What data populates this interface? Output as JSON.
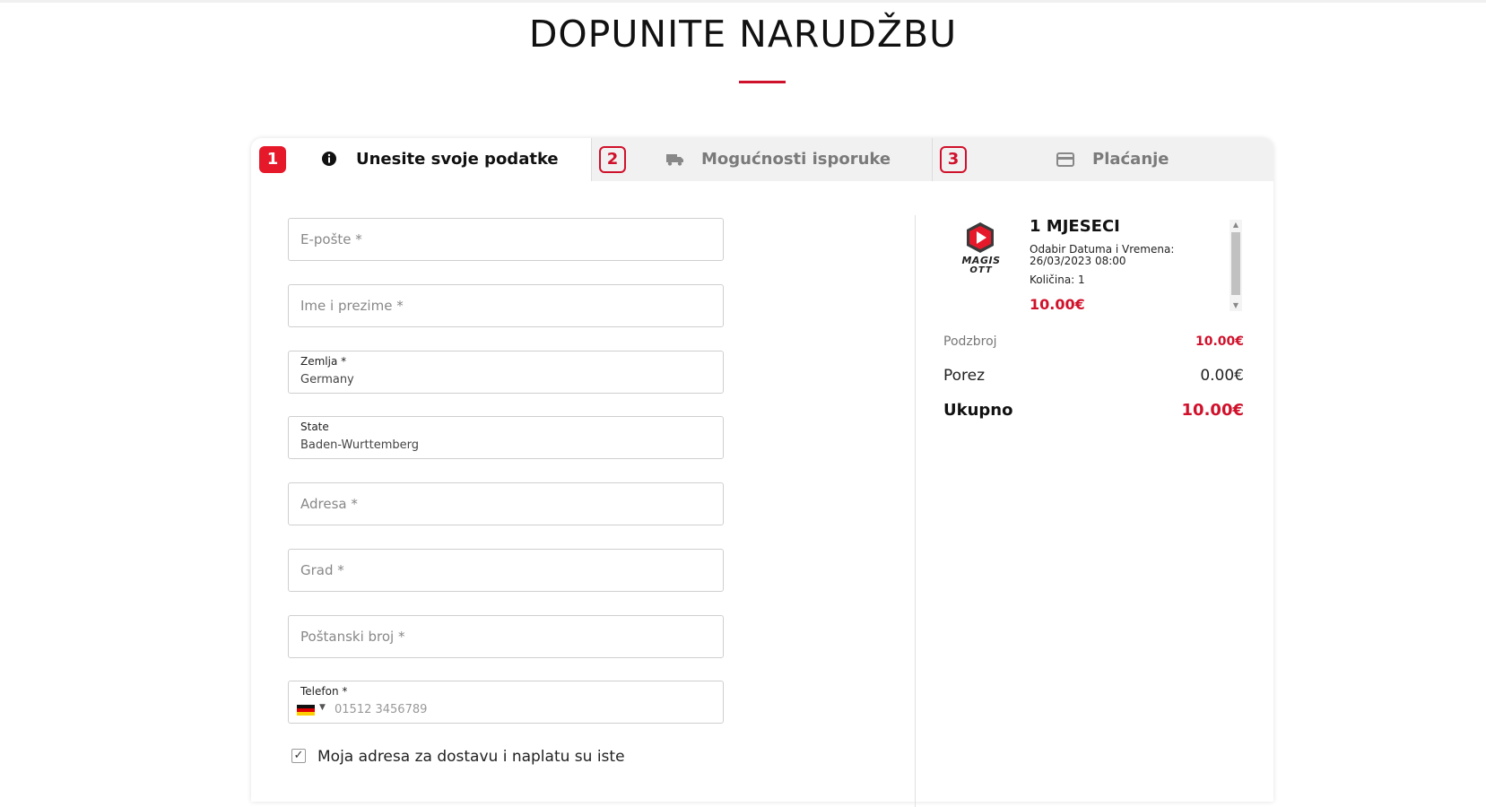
{
  "page": {
    "title": "DOPUNITE NARUDŽBU"
  },
  "steps": [
    {
      "num": "1",
      "label": "Unesite svoje podatke",
      "icon": "info-icon"
    },
    {
      "num": "2",
      "label": "Mogućnosti isporuke",
      "icon": "truck-icon"
    },
    {
      "num": "3",
      "label": "Plaćanje",
      "icon": "credit-card-icon"
    }
  ],
  "form": {
    "email": {
      "placeholder": "E-pošte  *"
    },
    "name": {
      "placeholder": "Ime i prezime  *"
    },
    "country": {
      "label": "Zemlja  *",
      "value": "Germany"
    },
    "state": {
      "label": "State",
      "value": "Baden-Wurttemberg"
    },
    "address": {
      "placeholder": "Adresa  *"
    },
    "city": {
      "placeholder": "Grad  *"
    },
    "postal": {
      "placeholder": "Poštanski broj  *"
    },
    "phone": {
      "label": "Telefon  *",
      "placeholder": "01512 3456789",
      "flag": "germany-flag"
    },
    "same_address": {
      "label": "Moja adresa za dostavu i naplatu su iste",
      "checked": true
    }
  },
  "summary": {
    "product": {
      "logo_line1": "MAGIS",
      "logo_line2": "OTT",
      "name": "1 MJESECI",
      "date_label": "Odabir Datuma i Vremena: 26/03/2023 08:00",
      "qty_label": "Količina: 1",
      "price": "10.00€"
    },
    "subtotal_label": "Podzbroj",
    "subtotal_value": "10.00€",
    "tax_label": "Porez",
    "tax_value": "0.00€",
    "total_label": "Ukupno",
    "total_value": "10.00€"
  },
  "colors": {
    "accent": "#d0112b",
    "accent_bright": "#e6192b"
  }
}
